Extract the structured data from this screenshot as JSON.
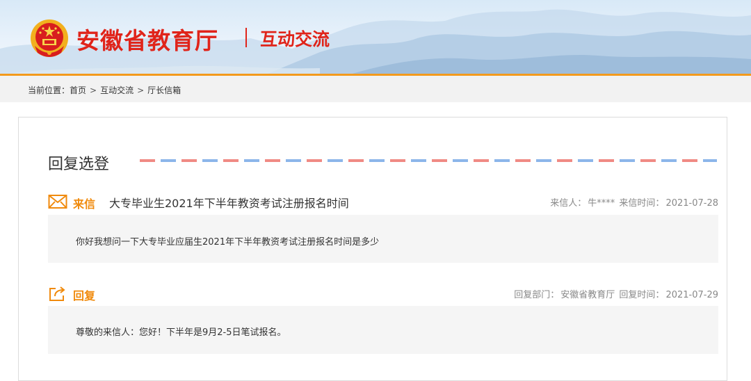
{
  "header": {
    "site_title": "安徽省教育厅",
    "section_title": "互动交流"
  },
  "breadcrumb": {
    "prefix": "当前位置：",
    "items": [
      "首页",
      "互动交流",
      "厅长信箱"
    ],
    "separator": ">"
  },
  "panel": {
    "heading": "回复选登",
    "letter": {
      "kind_label": "来信",
      "subject": "大专毕业生2021年下半年教资考试注册报名时间",
      "sender_label": "来信人：",
      "sender": "牛****",
      "date_label": "来信时间：",
      "date": "2021-07-28",
      "body": "你好我想问一下大专毕业应届生2021年下半年教资考试注册报名时间是多少"
    },
    "reply": {
      "kind_label": "回复",
      "dept_label": "回复部门：",
      "dept": "安徽省教育厅",
      "date_label": "回复时间：",
      "date": "2021-07-29",
      "body": "尊敬的来信人：您好！下半年是9月2-5日笔试报名。"
    }
  },
  "colors": {
    "brand_red": "#e0241a",
    "accent_orange": "#f08a0c",
    "header_line": "#f39a1d",
    "airmail_red": "#f08a84",
    "airmail_blue": "#8cb6ea"
  },
  "icons": {
    "emblem": "national-emblem-icon",
    "letter": "envelope-icon",
    "reply": "share-reply-icon"
  }
}
